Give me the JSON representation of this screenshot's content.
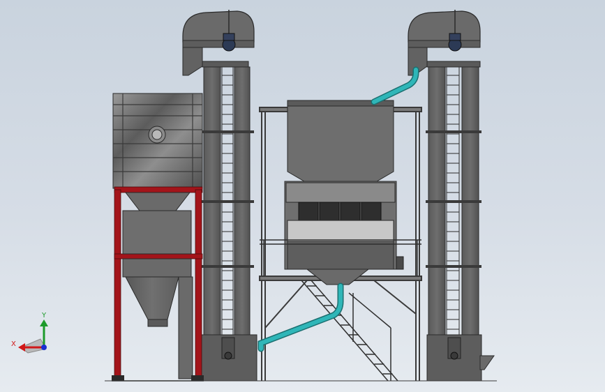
{
  "triad": {
    "x_label": "X",
    "y_label": "Y",
    "x_color": "#d01818",
    "y_color": "#1c9a2a",
    "z_color": "#1a2fd0"
  },
  "colors": {
    "steel": "#6b6b6b",
    "steel_dark": "#4a4a4a",
    "frame": "#7a7a7a",
    "red_frame": "#a3141a",
    "pipe": "#2fb6b8",
    "motor": "#2c3a55"
  }
}
